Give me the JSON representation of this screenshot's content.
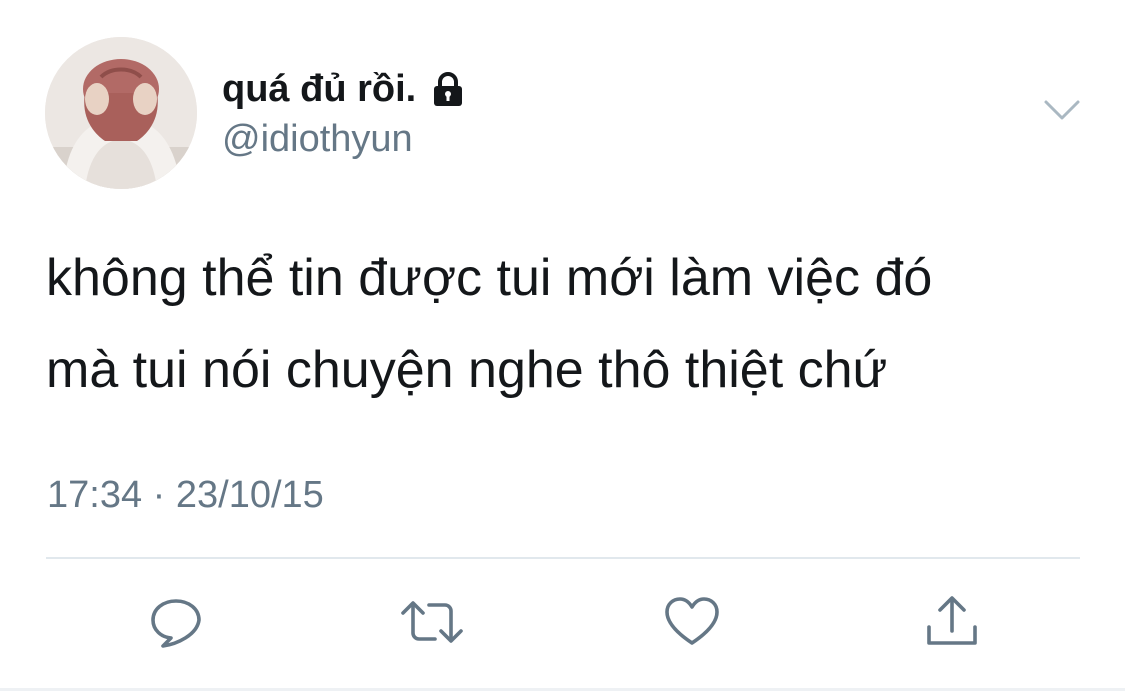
{
  "tweet": {
    "display_name": "quá đủ rồi.",
    "handle": "@idiothyun",
    "text": "không thể tin được tui mới làm việc đó\nmà tui nói chuyện nghe thô thiệt chứ",
    "time": "17:34",
    "separator": "·",
    "date": "23/10/15",
    "protected": true
  },
  "icons": {
    "lock": "lock-icon",
    "menu": "chevron-down-icon",
    "reply": "reply-icon",
    "retweet": "retweet-icon",
    "like": "heart-icon",
    "share": "share-icon"
  },
  "colors": {
    "text": "#14171a",
    "secondary": "#657786",
    "icon": "#657786",
    "divider": "#e1e8ed",
    "chevron": "#aab8c2"
  }
}
